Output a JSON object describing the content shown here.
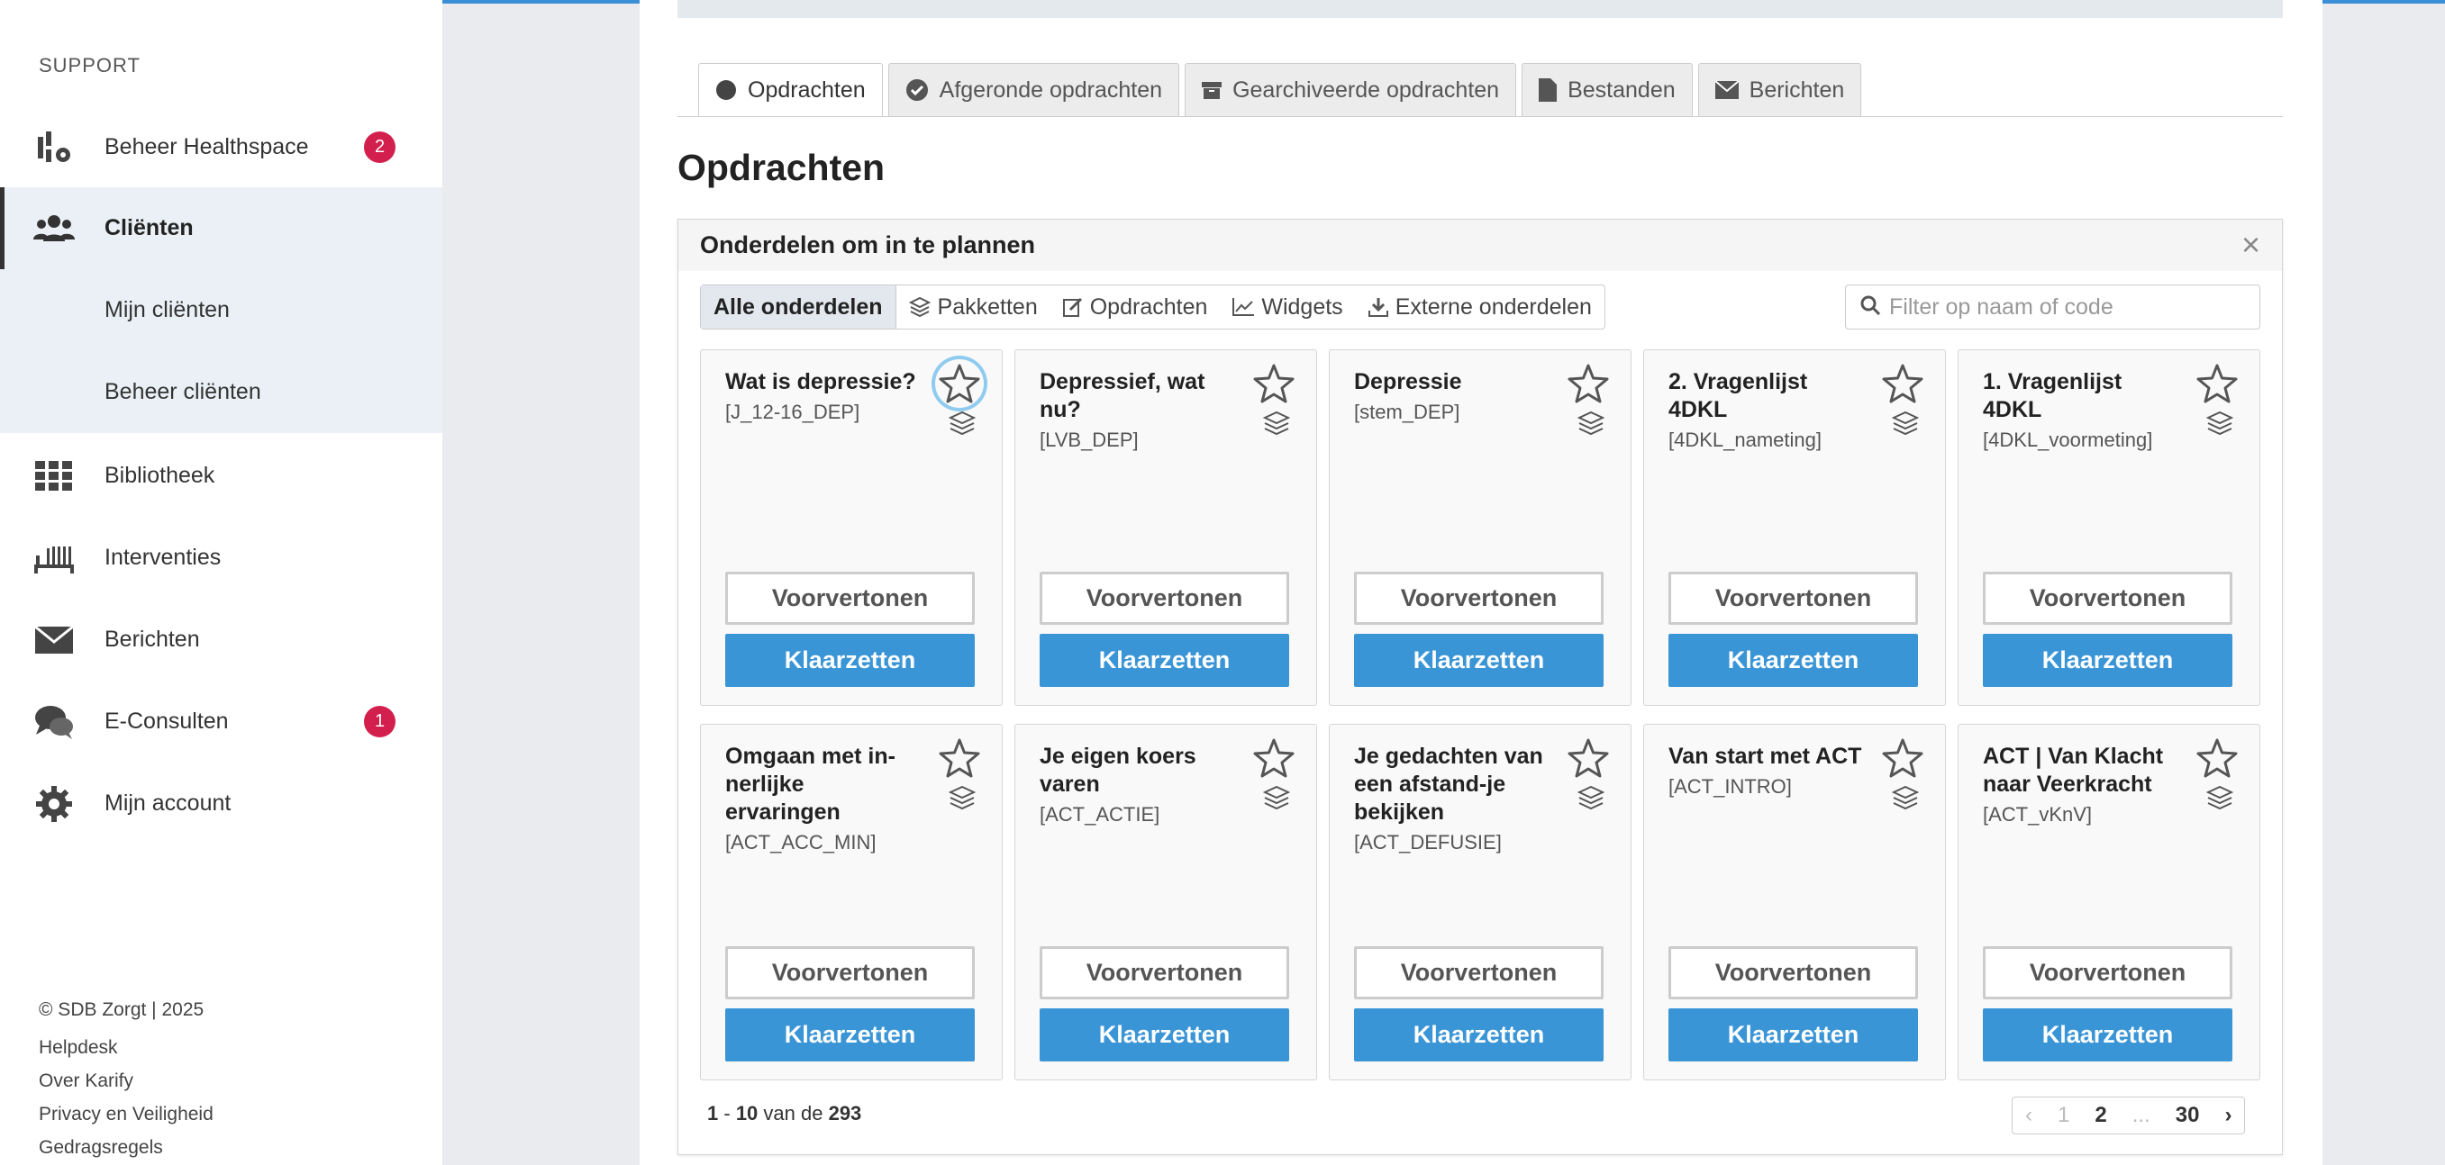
{
  "sidebar": {
    "section": "SUPPORT",
    "items": [
      {
        "label": "Beheer Healthspace",
        "icon": "healthspace-icon",
        "badge": "2"
      },
      {
        "label": "Cliënten",
        "icon": "users-icon",
        "active": true
      },
      {
        "label": "Mijn cliënten"
      },
      {
        "label": "Beheer cliënten"
      },
      {
        "label": "Bibliotheek",
        "icon": "grid-icon"
      },
      {
        "label": "Interventies",
        "icon": "interventions-icon"
      },
      {
        "label": "Berichten",
        "icon": "envelope-icon"
      },
      {
        "label": "E-Consulten",
        "icon": "chat-icon",
        "badge": "1"
      },
      {
        "label": "Mijn account",
        "icon": "gear-icon"
      }
    ],
    "footer": [
      "© SDB Zorgt | 2025",
      "Helpdesk",
      "Over Karify",
      "Privacy en Veiligheid",
      "Gedragsregels"
    ]
  },
  "tabs": [
    {
      "label": "Opdrachten",
      "icon": "circle-icon",
      "active": true
    },
    {
      "label": "Afgeronde opdrachten",
      "icon": "check-circle-icon"
    },
    {
      "label": "Gearchiveerde opdrachten",
      "icon": "archive-icon"
    },
    {
      "label": "Bestanden",
      "icon": "file-icon"
    },
    {
      "label": "Berichten",
      "icon": "envelope-icon"
    }
  ],
  "page_title": "Opdrachten",
  "modal": {
    "title": "Onderdelen om in te plannen",
    "close": "×",
    "filters": [
      {
        "label": "Alle onderdelen",
        "active": true
      },
      {
        "label": "Pakketten",
        "icon": "layers-icon"
      },
      {
        "label": "Opdrachten",
        "icon": "edit-icon"
      },
      {
        "label": "Widgets",
        "icon": "chart-icon"
      },
      {
        "label": "Externe onderdelen",
        "icon": "import-icon"
      }
    ],
    "search_placeholder": "Filter op naam of code",
    "preview_label": "Voorvertonen",
    "assign_label": "Klaarzetten",
    "cards": [
      {
        "title": "Wat is depressie?",
        "code": "[J_12-16_DEP]"
      },
      {
        "title": "Depressief, wat nu?",
        "code": "[LVB_DEP]"
      },
      {
        "title": "Depressie",
        "code": "[stem_DEP]"
      },
      {
        "title": "2. Vragenlijst 4DKL",
        "code": "[4DKL_nameting]"
      },
      {
        "title": "1. Vragenlijst 4DKL",
        "code": "[4DKL_voormeting]"
      },
      {
        "title": "Omgaan met in-nerlijke ervaringen",
        "code": "[ACT_ACC_MIN]"
      },
      {
        "title": "Je eigen koers varen",
        "code": "[ACT_ACTIE]"
      },
      {
        "title": "Je gedachten van een afstand-je bekijken",
        "code": "[ACT_DEFUSIE]"
      },
      {
        "title": "Van start met ACT",
        "code": "[ACT_INTRO]"
      },
      {
        "title": "ACT | Van Klacht naar Veerkracht",
        "code": "[ACT_vKnV]"
      }
    ],
    "count": {
      "from": "1",
      "to": "10",
      "sep": " - ",
      "mid": " van de ",
      "total": "293"
    },
    "pager": {
      "prev": "‹",
      "pages": [
        "1",
        "2",
        "...",
        "30"
      ],
      "next": "›"
    }
  },
  "colors": {
    "accent": "#3a95d6",
    "badge": "#d21f4d"
  }
}
